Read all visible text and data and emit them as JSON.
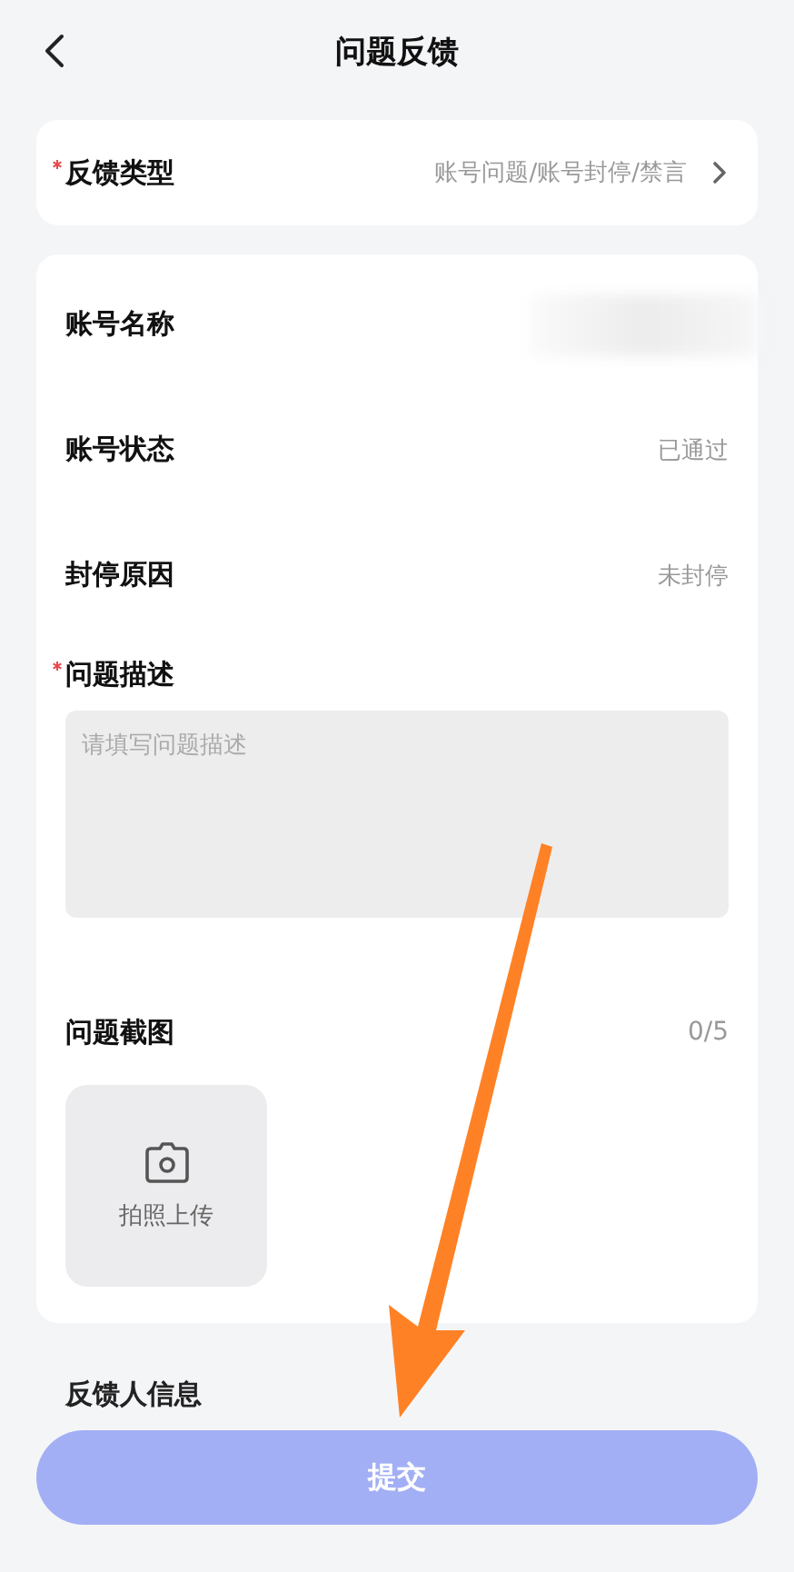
{
  "header": {
    "title": "问题反馈"
  },
  "type_field": {
    "label": "反馈类型",
    "required": true,
    "value": "账号问题/账号封停/禁言"
  },
  "info_rows": [
    {
      "label": "账号名称",
      "kind": "blurred"
    },
    {
      "label": "账号状态",
      "kind": "text",
      "value": "已通过"
    },
    {
      "label": "封停原因",
      "kind": "text",
      "value": "未封停"
    }
  ],
  "description": {
    "label": "问题描述",
    "required": true,
    "placeholder": "请填写问题描述"
  },
  "screenshots": {
    "label": "问题截图",
    "count": "0/5",
    "upload_label": "拍照上传"
  },
  "section_title": "反馈人信息",
  "submit_button": {
    "label": "提交",
    "disabled": true
  }
}
